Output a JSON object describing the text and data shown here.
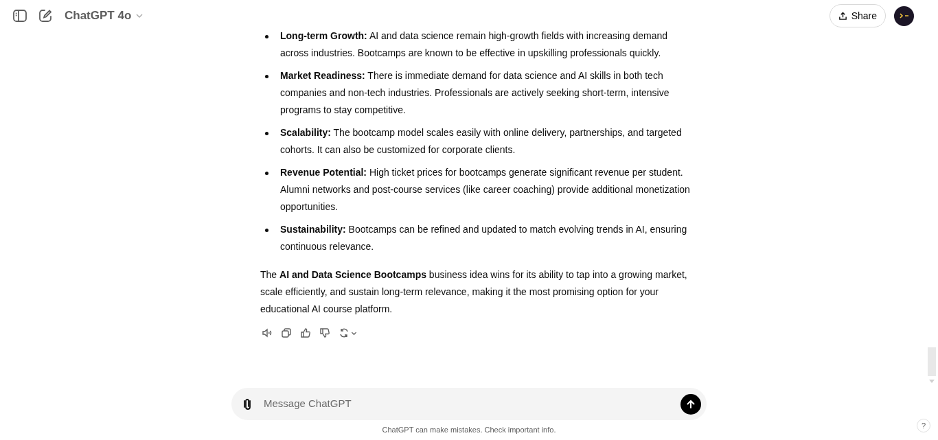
{
  "header": {
    "model": "ChatGPT 4o",
    "share": "Share"
  },
  "bullets": [
    {
      "text": "**Long-term Growth:** AI and data science remain high-growth fields with increasing demand across industries. Bootcamps are known to be effective in upskilling professionals quickly."
    },
    {
      "text": "**Market Readiness:** There is immediate demand for data science and AI skills in both tech companies and non-tech industries. Professionals are actively seeking short-term, intensive programs to stay competitive."
    },
    {
      "text": "**Scalability:** The bootcamp model scales easily with online delivery, partnerships, and targeted cohorts. It can also be customized for corporate clients."
    },
    {
      "text": "**Revenue Potential:** High ticket prices for bootcamps generate significant revenue per student. Alumni networks and post-course services (like career coaching) provide additional monetization opportunities."
    },
    {
      "text": "**Sustainability:** Bootcamps can be refined and updated to match evolving trends in AI, ensuring continuous relevance."
    }
  ],
  "conclusion": "The **AI and Data Science Bootcamps** business idea wins for its ability to tap into a growing market, scale efficiently, and sustain long-term relevance, making it the most promising option for your educational AI course platform.",
  "composer": {
    "placeholder": "Message ChatGPT"
  },
  "disclaimer": "ChatGPT can make mistakes. Check important info.",
  "help": "?"
}
